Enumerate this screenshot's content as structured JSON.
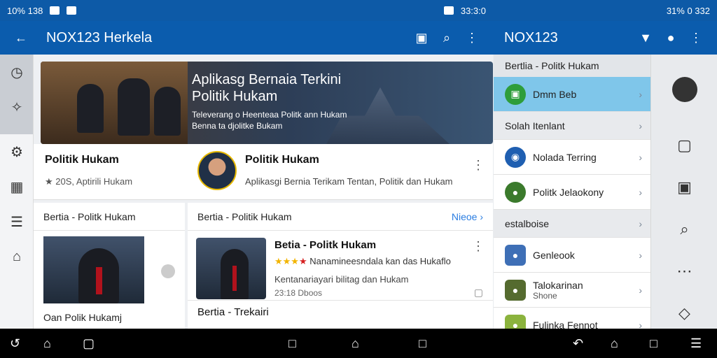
{
  "status_left": {
    "left_text": "10%  138",
    "right_text": "33:3:0"
  },
  "status_right": {
    "text": "31%  0 332"
  },
  "appbar_left": {
    "title": "NOX123 Herkela"
  },
  "appbar_right": {
    "title": "NOX123"
  },
  "banner": {
    "title": "Aplikasg Bernaia Terkini\nPolitik Hukam",
    "subtitle": "Televerang o Heenteaa Politk ann Hukam\nBenna ta djolitke Bukam"
  },
  "row1": {
    "left_name": "Politik Hukam",
    "left_meta": "★ 20S, Aptirili Hukam",
    "right_name": "Politik Hukam",
    "right_desc": "Aplikasgi Bernia Terikam Tentan, Politik dan Hukam"
  },
  "panel_a": {
    "header": "Bertia - Politk Hukam",
    "footer": "Oan Polik Hukamj"
  },
  "panel_b": {
    "header": "Bertia - Politik Hukam",
    "link": "Nieoe ›",
    "item_title": "Betia - Politk Hukam",
    "item_desc1": "Nanamineesndala kan das Hukaflo",
    "item_desc2": "Kentanariayari bilitag dan Hukam",
    "item_meta": "23:18 Dboos",
    "next_title": "Bertia - Trekairi"
  },
  "right_panel": {
    "header": "Bertlia - Politk Hukam",
    "items": [
      {
        "label": "Dmm Beb",
        "color": "#2e9d3b",
        "selected": true
      },
      {
        "label": "Solah Itenlant",
        "grey": true
      },
      {
        "label": "Nolada Terring",
        "color": "#1f5fb1"
      },
      {
        "label": "Politk Jelaokony",
        "color": "#3b7a2c"
      },
      {
        "label": "estalboise",
        "grey": true
      },
      {
        "label": "Genleook",
        "color": "#3e6fb6"
      },
      {
        "label": "Talokarinan",
        "sub": "Shone",
        "color": "#556b2f"
      },
      {
        "label": "Fulinka Fennot",
        "color": "#8bb33d"
      }
    ]
  }
}
